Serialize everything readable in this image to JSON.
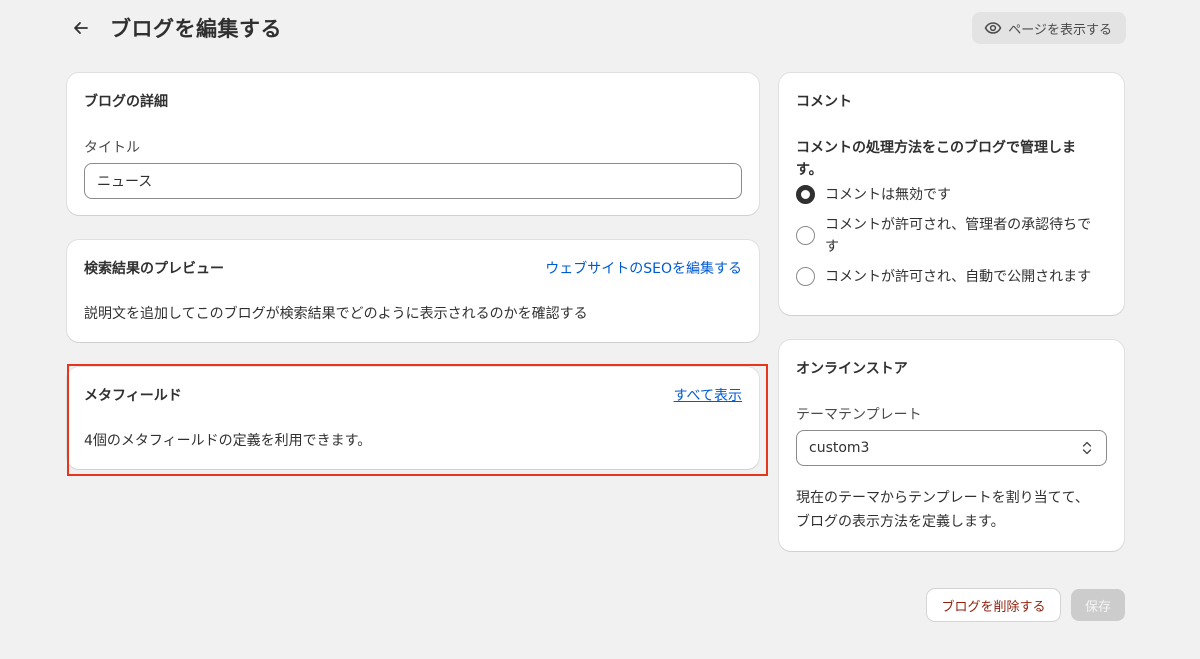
{
  "header": {
    "title": "ブログを編集する",
    "view_page_label": "ページを表示する"
  },
  "blog_details": {
    "title": "ブログの詳細",
    "title_label": "タイトル",
    "title_value": "ニュース"
  },
  "seo_preview": {
    "title": "検索結果のプレビュー",
    "edit_link": "ウェブサイトのSEOを編集する",
    "description": "説明文を追加してこのブログが検索結果でどのように表示されるのかを確認する"
  },
  "metafields": {
    "title": "メタフィールド",
    "view_all_link": "すべて表示",
    "description": "4個のメタフィールドの定義を利用できます。"
  },
  "comments": {
    "title": "コメント",
    "question": "コメントの処理方法をこのブログで管理しま\nす。",
    "options": [
      {
        "label": "コメントは無効です",
        "checked": true
      },
      {
        "label": "コメントが許可され、管理者の承認待ちで\nす",
        "checked": false
      },
      {
        "label": "コメントが許可され、自動で公開されます",
        "checked": false
      }
    ]
  },
  "online_store": {
    "title": "オンラインストア",
    "template_label": "テーマテンプレート",
    "template_value": "custom3",
    "help_text": "現在のテーマからテンプレートを割り当てて、\nブログの表示方法を定義します。"
  },
  "footer": {
    "delete_label": "ブログを削除する",
    "save_label": "保存"
  },
  "colors": {
    "background": "#f1f1f1",
    "link": "#005bd3",
    "highlight": "#e8361c",
    "danger_text": "#8e1f0b"
  }
}
